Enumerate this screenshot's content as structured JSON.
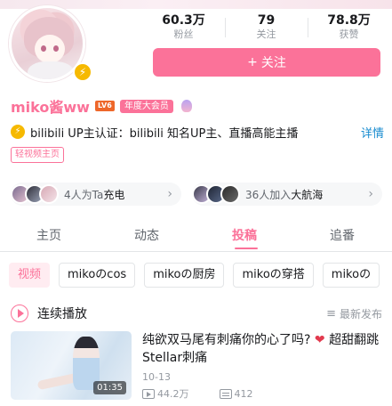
{
  "profile": {
    "name": "miko酱ww",
    "level": "LV6",
    "vip_label": "年度大会员",
    "short_video_tag": "轻视频主页",
    "follow_label": "关注",
    "follow_icon": "+",
    "verify_icon": "lightning-icon"
  },
  "stats": [
    {
      "value": "60.3万",
      "label": "粉丝"
    },
    {
      "value": "79",
      "label": "关注"
    },
    {
      "value": "78.8万",
      "label": "获赞"
    }
  ],
  "certification": {
    "text": "bilibili  UP主认证：bilibili  知名UP主、直播高能主播",
    "more": "详情"
  },
  "charge_pill": {
    "text": "4人为Ta",
    "strong": "充电"
  },
  "guard_pill": {
    "text": "36人加入",
    "strong": "大航海"
  },
  "tabs": [
    {
      "label": "主页"
    },
    {
      "label": "动态"
    },
    {
      "label": "投稿"
    },
    {
      "label": "追番"
    }
  ],
  "active_tab": "投稿",
  "chips": [
    {
      "label": "视频"
    },
    {
      "label": "mikoのcos"
    },
    {
      "label": "mikoの厨房"
    },
    {
      "label": "mikoの穿搭"
    },
    {
      "label": "mikoの"
    }
  ],
  "playlist": {
    "label": "连续播放",
    "sort_icon": "≡",
    "sort_label": "最新发布"
  },
  "video": {
    "title_part1": "纯欲双马尾有刺痛你的心了吗?",
    "heart": "❤",
    "title_part2": "超甜翻跳Stellar刺痛",
    "duration": "01:35",
    "date": "10-13",
    "views": "44.2万",
    "danmaku": "412"
  },
  "colors": {
    "accent": "#fb7299",
    "link": "#178bcf",
    "verify": "#f6b900"
  }
}
